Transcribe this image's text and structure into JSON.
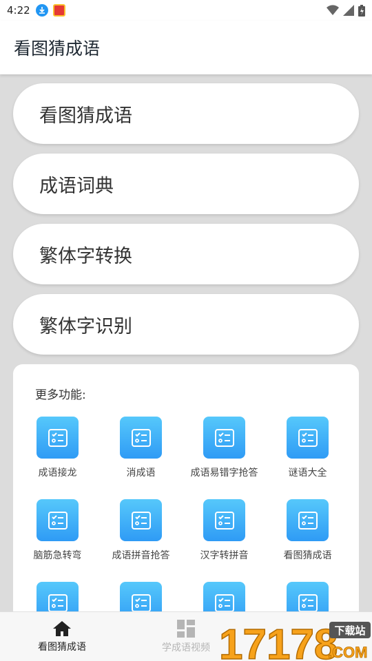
{
  "status_bar": {
    "time": "4:22",
    "left_icons": [
      "download-icon",
      "app-notification-icon"
    ],
    "right_icons": [
      "wifi-icon",
      "signal-icon",
      "battery-icon"
    ]
  },
  "app_bar": {
    "title": "看图猜成语"
  },
  "main_buttons": [
    {
      "label": "看图猜成语"
    },
    {
      "label": "成语词典"
    },
    {
      "label": "繁体字转换"
    },
    {
      "label": "繁体字识别"
    }
  ],
  "more_features": {
    "heading": "更多功能:",
    "icon": "list-check-icon",
    "items": [
      {
        "label": "成语接龙"
      },
      {
        "label": "消成语"
      },
      {
        "label": "成语易错字抢答"
      },
      {
        "label": "谜语大全"
      },
      {
        "label": "脑筋急转弯"
      },
      {
        "label": "成语拼音抢答"
      },
      {
        "label": "汉字转拼音"
      },
      {
        "label": "看图猜成语"
      },
      {
        "label": ""
      },
      {
        "label": ""
      },
      {
        "label": ""
      },
      {
        "label": ""
      }
    ]
  },
  "bottom_nav": {
    "items": [
      {
        "label": "看图猜成语",
        "icon": "home-icon",
        "active": true
      },
      {
        "label": "学成语视频",
        "icon": "dashboard-icon",
        "active": false
      }
    ]
  },
  "watermark": {
    "text": "17178",
    "tag": "下载站",
    "suffix": ".COM"
  },
  "colors": {
    "accent_gradient_top": "#56c8fb",
    "accent_gradient_bottom": "#2f9bf5",
    "background": "#dcdcdc",
    "nav_active": "#222222",
    "nav_inactive": "#b5b5b5",
    "watermark_orange": "#f7a21b"
  }
}
